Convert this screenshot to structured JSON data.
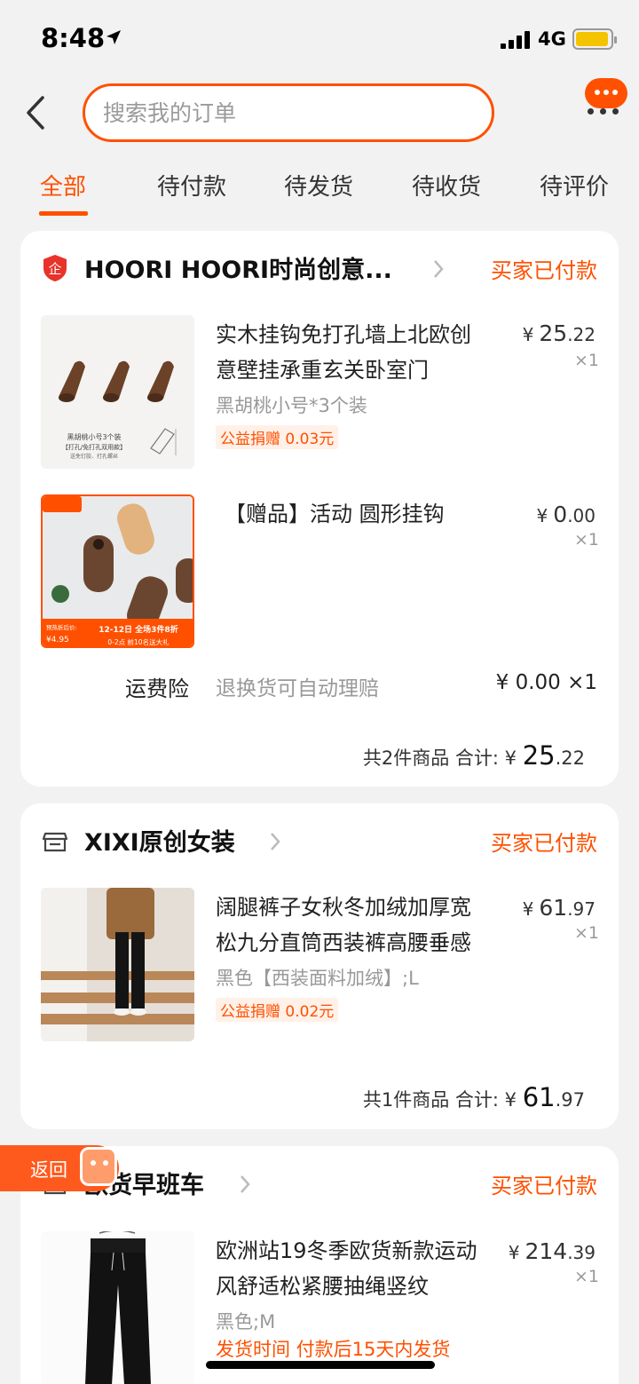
{
  "status_bar": {
    "time": "8:48",
    "network": "4G"
  },
  "search": {
    "placeholder": "搜索我的订单"
  },
  "tabs": [
    {
      "label": "全部"
    },
    {
      "label": "待付款"
    },
    {
      "label": "待发货"
    },
    {
      "label": "待收货"
    },
    {
      "label": "待评价"
    }
  ],
  "orders": [
    {
      "shop_name": "HOORI HOORI时尚创意...",
      "status": "买家已付款",
      "items": [
        {
          "title": "实木挂钩免打孔墙上北欧创意壁挂承重玄关卧室门",
          "spec": "黑胡桃小号*3个装",
          "tag": "公益捐赠 0.03元",
          "price_currency": "¥",
          "price_int": "25",
          "price_dec": ".22",
          "qty": "×1",
          "thumb_caption_1": "黑胡桃小号3个装",
          "thumb_caption_2": "【打孔/免打孔双用款】",
          "thumb_caption_3": "送免钉胶、打孔螺丝"
        },
        {
          "title": "【赠品】活动 圆形挂钩",
          "price_currency": "¥",
          "price_int": "0",
          "price_dec": ".00",
          "qty": "×1",
          "thumb_banner_1": "12-12日 全场3件8折",
          "thumb_banner_2": "0-2点 前10名送大礼",
          "thumb_price_label": "预热折后价:",
          "thumb_price": "¥4.95"
        }
      ],
      "insurance": {
        "label": "运费险",
        "desc": "退换货可自动理赔",
        "price": "¥ 0.00 ×1"
      },
      "total": {
        "prefix": "共2件商品  合计: ¥ ",
        "amount_int": "25",
        "amount_dec": ".22"
      }
    },
    {
      "shop_name": "XIXI原创女装",
      "status": "买家已付款",
      "items": [
        {
          "title": "阔腿裤子女秋冬加绒加厚宽松九分直筒西装裤高腰垂感",
          "spec": "黑色【西装面料加绒】;L",
          "tag": "公益捐赠 0.02元",
          "price_currency": "¥",
          "price_int": "61",
          "price_dec": ".97",
          "qty": "×1"
        }
      ],
      "total": {
        "prefix": "共1件商品  合计: ¥ ",
        "amount_int": "61",
        "amount_dec": ".97"
      }
    },
    {
      "shop_name": "欧货早班车",
      "status": "买家已付款",
      "items": [
        {
          "title": "欧洲站19冬季欧货新款运动风舒适松紧腰抽绳竖纹",
          "spec": "黑色;M",
          "tag": "发货时间  付款后15天内发货",
          "price_currency": "¥",
          "price_int": "214",
          "price_dec": ".39",
          "qty": "×1"
        }
      ]
    }
  ],
  "float_back": {
    "label": "返回"
  },
  "colors": {
    "accent": "#ff5000",
    "background": "#f2f2f2",
    "card": "#ffffff",
    "muted": "#999999"
  },
  "icons": [
    "back-arrow-icon",
    "message-icon",
    "more-icon",
    "enterprise-shield-icon",
    "store-icon",
    "chevron-right-icon",
    "location-arrow-icon"
  ]
}
